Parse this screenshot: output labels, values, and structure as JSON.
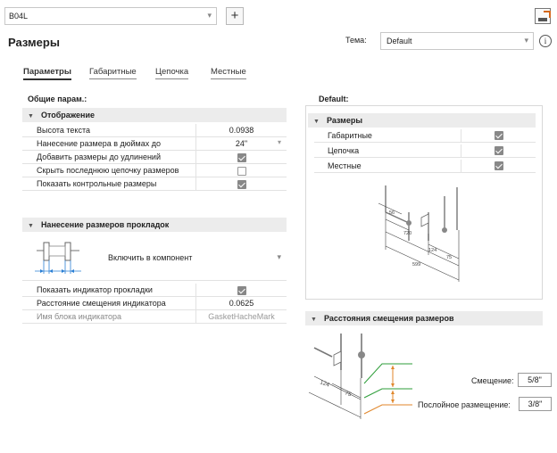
{
  "toolbar": {
    "style_name": "B04L",
    "add_symbol": "+"
  },
  "header": {
    "title": "Размеры",
    "theme_label": "Тема:",
    "theme_value": "Default",
    "info_symbol": "i"
  },
  "tabs": [
    {
      "label": "Параметры",
      "active": true
    },
    {
      "label": "Габаритные",
      "active": false
    },
    {
      "label": "Цепочка",
      "active": false
    },
    {
      "label": "Местные",
      "active": false
    }
  ],
  "left": {
    "caption": "Общие парам.:",
    "display_group": {
      "title": "Отображение",
      "rows": [
        {
          "label": "Высота текста",
          "value": "0.0938"
        },
        {
          "label": "Нанесение размера в дюймах до",
          "value": "24\""
        },
        {
          "label": "Добавить размеры до удлинений",
          "checked": true
        },
        {
          "label": "Скрыть последнюю цепочку размеров",
          "checked": false
        },
        {
          "label": "Показать контрольные размеры",
          "checked": true
        }
      ]
    },
    "gasket_group": {
      "title": "Нанесение размеров прокладок",
      "mode_value": "Включить в компонент",
      "rows": [
        {
          "label": "Показать индикатор прокладки",
          "checked": true
        },
        {
          "label": "Расстояние смещения индикатора",
          "value": "0.0625"
        },
        {
          "label": "Имя блока индикатора",
          "value": "GasketHacheMark"
        }
      ]
    }
  },
  "right": {
    "caption": "Default:",
    "dims_group": {
      "title": "Размеры",
      "rows": [
        {
          "label": "Габаритные",
          "checked": true
        },
        {
          "label": "Цепочка",
          "checked": true
        },
        {
          "label": "Местные",
          "checked": true
        }
      ],
      "preview_labels": [
        "56",
        "720",
        "124",
        "75",
        "599"
      ]
    },
    "offset_group": {
      "title": "Расстояния смещения размеров",
      "offset_label": "Смещение:",
      "offset_value": "5/8\"",
      "layer_label": "Послойное размещение:",
      "layer_value": "3/8\"",
      "preview_labels": [
        "124",
        "75"
      ]
    }
  },
  "colors": {
    "header_bg": "#ececec",
    "green_line": "#2e9e3a",
    "orange_line": "#e0862a",
    "accent_blue": "#2a7fd4"
  }
}
